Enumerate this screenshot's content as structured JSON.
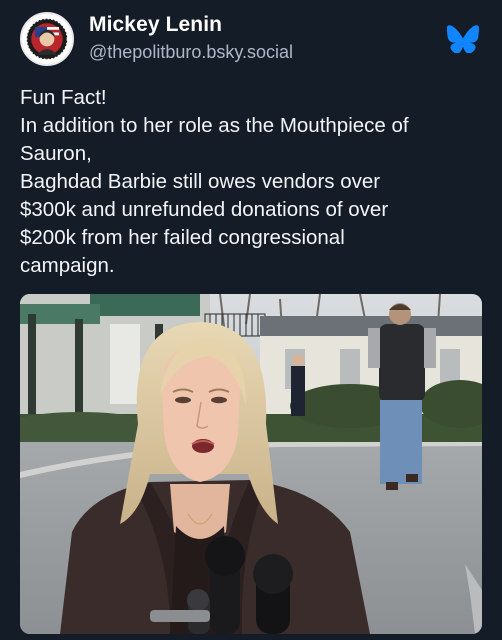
{
  "author": {
    "display_name": "Mickey Lenin",
    "handle": "@thepolitburo.bsky.social",
    "avatar_icon": "profile-photo-badge"
  },
  "platform": {
    "icon": "bluesky-butterfly-icon",
    "icon_color": "#1185fe"
  },
  "post": {
    "lines": [
      "Fun Fact!",
      "In addition to her role as the Mouthpiece of",
      "Sauron,",
      "Baghdad Barbie still owes vendors over",
      "$300k and unrefunded donations of over",
      "$200k from her failed congressional",
      "campaign."
    ]
  },
  "media": {
    "kind": "photo",
    "subject": "woman-speaking-at-microphones"
  },
  "colors": {
    "background": "#141c28",
    "text": "#f2f4f7",
    "handle": "#aeb8c4"
  }
}
